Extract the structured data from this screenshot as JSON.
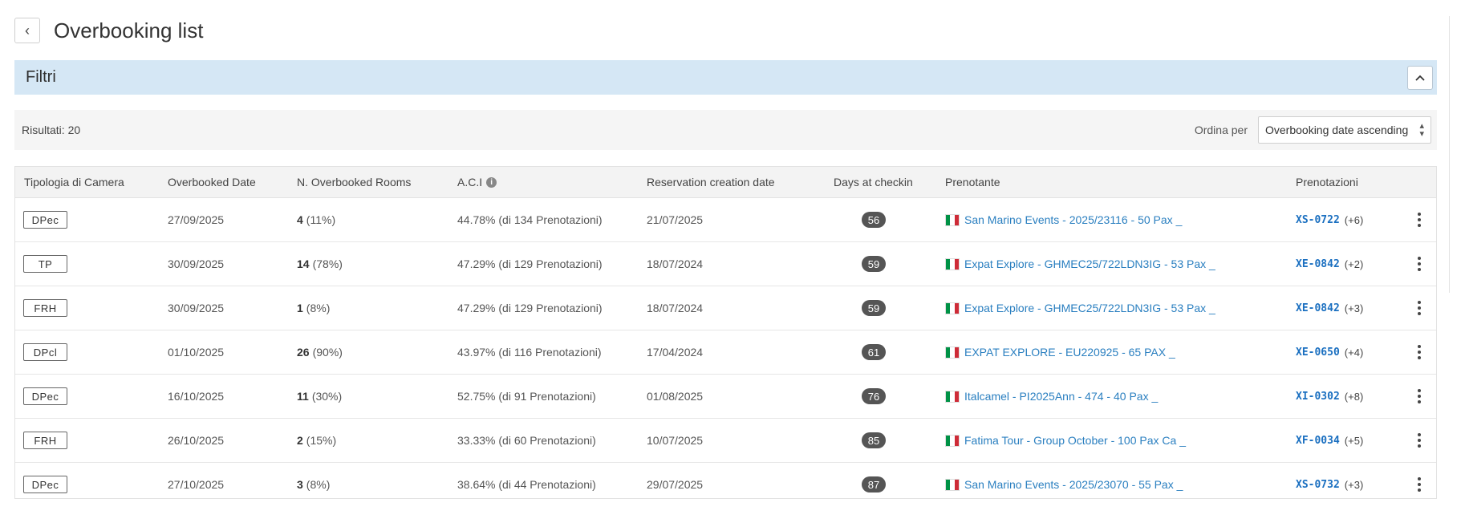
{
  "header": {
    "back_icon": "chevron-left-icon",
    "title": "Overbooking list"
  },
  "filters": {
    "title": "Filtri",
    "toggle_icon": "chevron-up-icon"
  },
  "results": {
    "count_label": "Risultati: 20",
    "sort_label": "Ordina per",
    "sort_value": "Overbooking date ascending"
  },
  "table": {
    "columns": {
      "room_type": "Tipologia di Camera",
      "overbooked_date": "Overbooked Date",
      "overbooked_rooms": "N. Overbooked Rooms",
      "aci": "A.C.I",
      "creation_date": "Reservation creation date",
      "days_checkin": "Days at checkin",
      "booker": "Prenotante",
      "reservations": "Prenotazioni"
    },
    "rows": [
      {
        "room": "DPec",
        "date": "27/09/2025",
        "rooms": "4",
        "pct": "(11%)",
        "aci": "44.78% (di 134 Prenotazioni)",
        "created": "21/07/2025",
        "days": "56",
        "booker": "San Marino Events - 2025/23116 - 50 Pax _",
        "code": "XS-0722",
        "extra": "(+6)"
      },
      {
        "room": "TP",
        "date": "30/09/2025",
        "rooms": "14",
        "pct": "(78%)",
        "aci": "47.29% (di 129 Prenotazioni)",
        "created": "18/07/2024",
        "days": "59",
        "booker": "Expat Explore - GHMEC25/722LDN3IG - 53 Pax _",
        "code": "XE-0842",
        "extra": "(+2)"
      },
      {
        "room": "FRH",
        "date": "30/09/2025",
        "rooms": "1",
        "pct": "(8%)",
        "aci": "47.29% (di 129 Prenotazioni)",
        "created": "18/07/2024",
        "days": "59",
        "booker": "Expat Explore - GHMEC25/722LDN3IG - 53 Pax _",
        "code": "XE-0842",
        "extra": "(+3)"
      },
      {
        "room": "DPcl",
        "date": "01/10/2025",
        "rooms": "26",
        "pct": "(90%)",
        "aci": "43.97% (di 116 Prenotazioni)",
        "created": "17/04/2024",
        "days": "61",
        "booker": "EXPAT EXPLORE - EU220925 - 65 PAX _",
        "code": "XE-0650",
        "extra": "(+4)"
      },
      {
        "room": "DPec",
        "date": "16/10/2025",
        "rooms": "11",
        "pct": "(30%)",
        "aci": "52.75% (di 91 Prenotazioni)",
        "created": "01/08/2025",
        "days": "76",
        "booker": "Italcamel - PI2025Ann - 474 - 40 Pax _",
        "code": "XI-0302",
        "extra": "(+8)"
      },
      {
        "room": "FRH",
        "date": "26/10/2025",
        "rooms": "2",
        "pct": "(15%)",
        "aci": "33.33% (di 60 Prenotazioni)",
        "created": "10/07/2025",
        "days": "85",
        "booker": "Fatima Tour - Group October - 100 Pax Ca _",
        "code": "XF-0034",
        "extra": "(+5)"
      },
      {
        "room": "DPec",
        "date": "27/10/2025",
        "rooms": "3",
        "pct": "(8%)",
        "aci": "38.64% (di 44 Prenotazioni)",
        "created": "29/07/2025",
        "days": "87",
        "booker": "San Marino Events - 2025/23070 - 55 Pax _",
        "code": "XS-0732",
        "extra": "(+3)"
      }
    ]
  },
  "colors": {
    "accent_link": "#2a7fc0",
    "filter_bar": "#d5e7f5",
    "pill": "#555555",
    "flag": [
      "#009246",
      "#ffffff",
      "#ce2b37"
    ]
  }
}
